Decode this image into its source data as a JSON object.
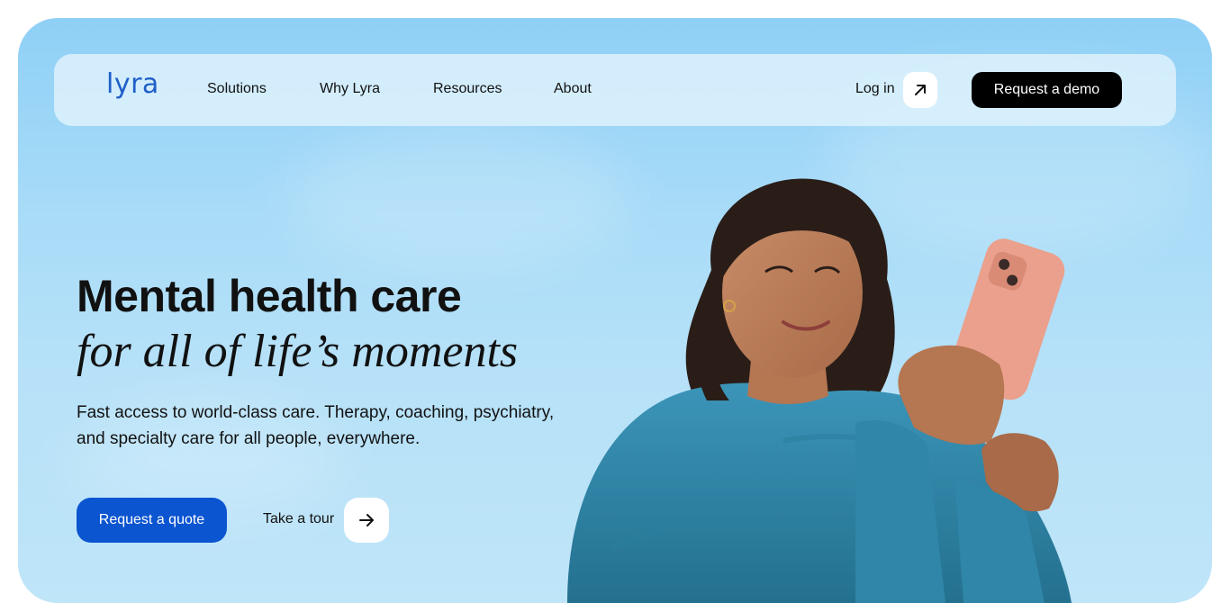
{
  "nav": {
    "logo": "lyra",
    "items": [
      {
        "label": "Solutions"
      },
      {
        "label": "Why Lyra"
      },
      {
        "label": "Resources"
      },
      {
        "label": "About"
      }
    ],
    "login_label": "Log in",
    "login_icon": "arrow-up-right-icon",
    "demo_label": "Request a demo"
  },
  "hero": {
    "headline": "Mental health care",
    "subheadline": "for all of life’s moments",
    "description": "Fast access to world-class care. Therapy, coaching, psychiatry, and specialty care for all people, everywhere.",
    "quote_label": "Request a quote",
    "tour_label": "Take a tour",
    "tour_icon": "arrow-right-icon"
  },
  "colors": {
    "brand_blue": "#1f5fc7",
    "primary_button": "#0b55d1",
    "sky": "#a9dcf8",
    "sweater": "#2f86a8",
    "phone_case": "#eaa08c"
  }
}
